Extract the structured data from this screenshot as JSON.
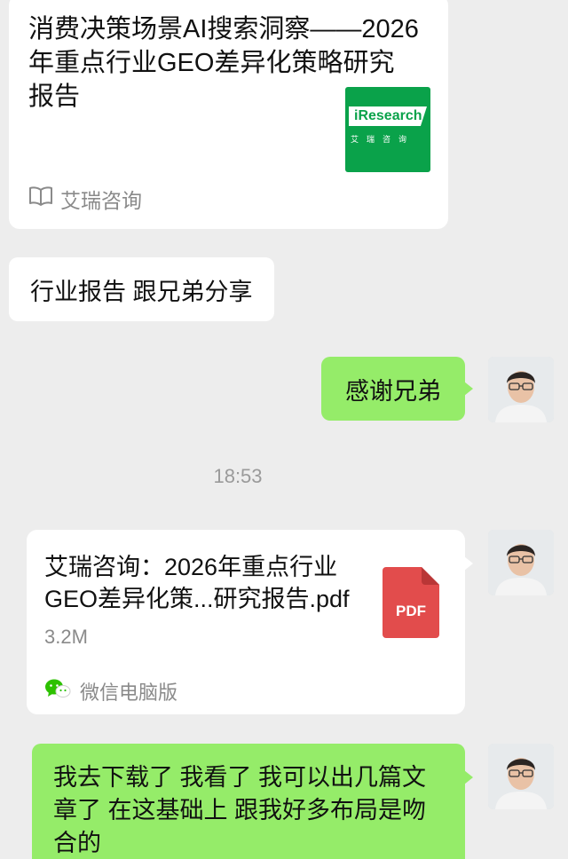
{
  "link_card": {
    "title": "消费决策场景AI搜索洞察——2026年重点行业GEO差异化策略研究报告",
    "logo_text": "iResearch",
    "logo_sub": "艾瑞咨询",
    "source": "艾瑞咨询",
    "logo_color": "#0aa24a"
  },
  "messages": {
    "left_text": "行业报告 跟兄弟分享",
    "right_thanks": "感谢兄弟",
    "timestamp": "18:53",
    "right_long": "我去下载了 我看了 我可以出几篇文章了 在这基础上 跟我好多布局是吻合的"
  },
  "file_card": {
    "name": "艾瑞咨询：2026年重点行业GEO差异化策...研究报告.pdf",
    "size": "3.2M",
    "pdf_label": "PDF",
    "source": "微信电脑版",
    "pdf_color": "#e24c4c"
  },
  "colors": {
    "background": "#ededed",
    "bubble_self": "#95ec69",
    "bubble_other": "#ffffff"
  },
  "icons": {
    "source_icon": "book-open-icon",
    "wechat_icon": "wechat-icon",
    "file_icon": "pdf-file-icon"
  }
}
